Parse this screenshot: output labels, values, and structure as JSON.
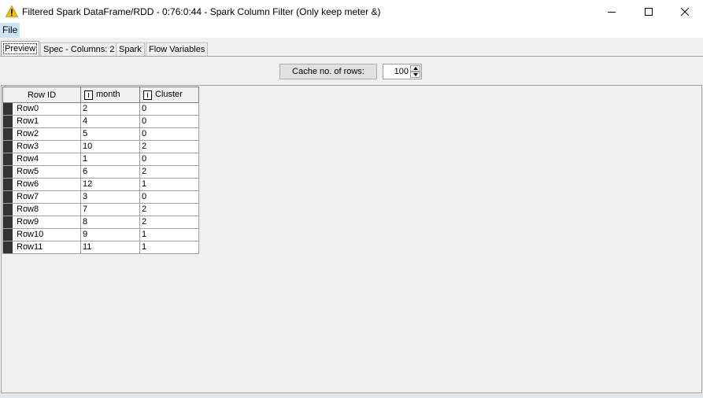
{
  "window": {
    "title": "Filtered Spark DataFrame/RDD - 0:76:0:44 - Spark Column Filter (Only keep meter &)",
    "icon": "warning-triangle-icon",
    "accent": "#f5c400"
  },
  "menu": {
    "file": "File"
  },
  "tabs": [
    {
      "label": "Preview"
    },
    {
      "label": "Spec - Columns: 2"
    },
    {
      "label": "Spark"
    },
    {
      "label": "Flow Variables"
    }
  ],
  "toolbar": {
    "cache_label": "Cache no. of rows:",
    "cache_value": "100"
  },
  "table": {
    "headers": {
      "row_id": "Row ID",
      "col1": "month",
      "col2": "Cluster"
    },
    "rows": [
      {
        "id": "Row0",
        "month": "2",
        "cluster": "0"
      },
      {
        "id": "Row1",
        "month": "4",
        "cluster": "0"
      },
      {
        "id": "Row2",
        "month": "5",
        "cluster": "0"
      },
      {
        "id": "Row3",
        "month": "10",
        "cluster": "2"
      },
      {
        "id": "Row4",
        "month": "1",
        "cluster": "0"
      },
      {
        "id": "Row5",
        "month": "6",
        "cluster": "2"
      },
      {
        "id": "Row6",
        "month": "12",
        "cluster": "1"
      },
      {
        "id": "Row7",
        "month": "3",
        "cluster": "0"
      },
      {
        "id": "Row8",
        "month": "7",
        "cluster": "2"
      },
      {
        "id": "Row9",
        "month": "8",
        "cluster": "2"
      },
      {
        "id": "Row10",
        "month": "9",
        "cluster": "1"
      },
      {
        "id": "Row11",
        "month": "11",
        "cluster": "1"
      }
    ]
  }
}
